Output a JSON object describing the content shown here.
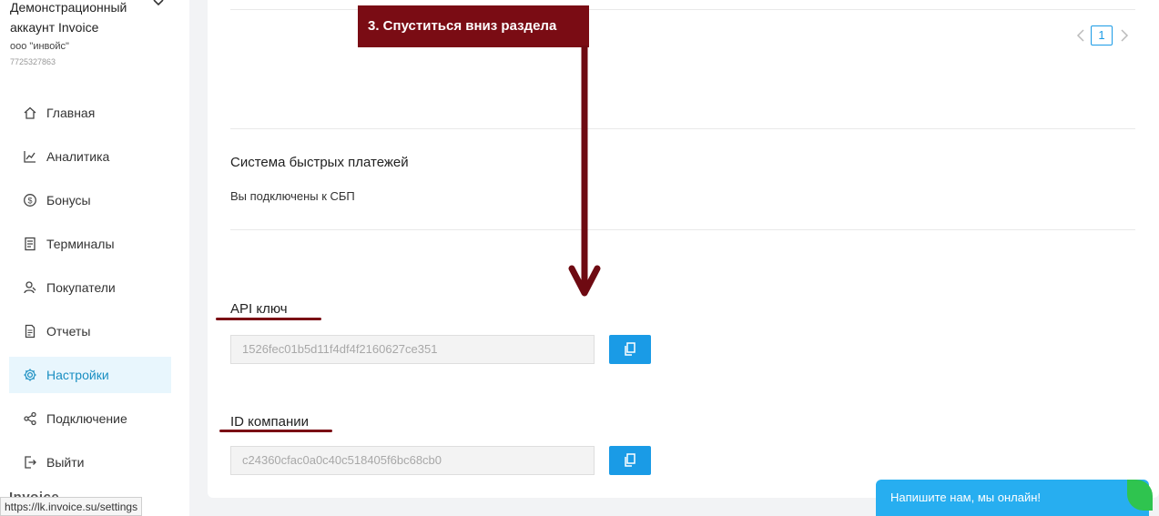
{
  "account": {
    "name": "Демонстрационный аккаунт Invoice",
    "org": "ооо \"инвойс\"",
    "inn": "7725327863"
  },
  "nav": [
    {
      "label": "Главная",
      "icon": "home-icon"
    },
    {
      "label": "Аналитика",
      "icon": "chart-line-icon"
    },
    {
      "label": "Бонусы",
      "icon": "dollar-circle-icon"
    },
    {
      "label": "Терминалы",
      "icon": "terminal-icon"
    },
    {
      "label": "Покупатели",
      "icon": "customers-icon"
    },
    {
      "label": "Отчеты",
      "icon": "report-icon"
    },
    {
      "label": "Настройки",
      "icon": "gear-icon",
      "active": true
    },
    {
      "label": "Подключение",
      "icon": "share-icon"
    },
    {
      "label": "Выйти",
      "icon": "logout-icon"
    }
  ],
  "brand": "Invoice",
  "status_url": "https://lk.invoice.su/settings",
  "pagination": {
    "current": "1"
  },
  "sbp": {
    "title": "Система быстрых платежей",
    "text": "Вы подключены к СБП"
  },
  "api_key": {
    "title": "API ключ",
    "value": "1526fec01b5d11f4df4f2160627ce351"
  },
  "company_id": {
    "title": "ID компании",
    "value": "c24360cfac0a0c40c518405f6bc68cb0"
  },
  "annotation": {
    "step_text": "3. Спуститься вниз раздела"
  },
  "chat": {
    "label": "Напишите нам, мы онлайн!"
  },
  "colors": {
    "accent": "#1a9be6",
    "annotation": "#7a0c14",
    "active_nav_bg": "#e8f6fd",
    "chat": "#27aef0"
  }
}
